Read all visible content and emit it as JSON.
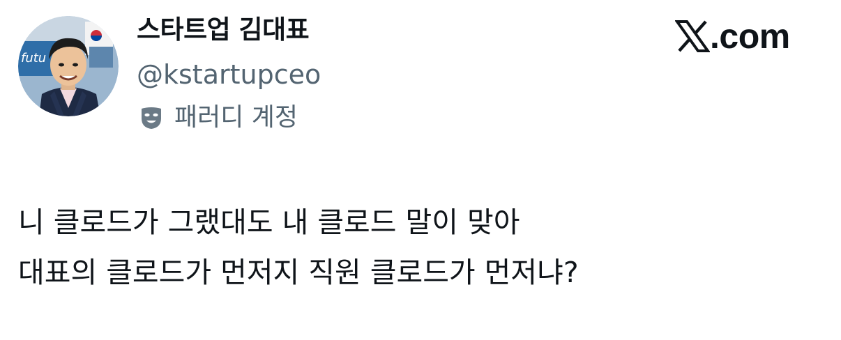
{
  "author": {
    "display_name": "스타트업 김대표",
    "handle": "@kstartupceo",
    "parody_label": "패러디 계정",
    "avatar_icon": "profile-avatar-illustration",
    "parody_icon": "theater-mask-icon"
  },
  "brand": {
    "label": ".com",
    "logo_icon": "x-logo-icon"
  },
  "tweet": {
    "lines": [
      "니 클로드가 그랬대도 내 클로드 말이 맞아",
      "대표의 클로드가 먼저지 직원 클로드가 먼저냐?"
    ]
  },
  "colors": {
    "text_primary": "#0f1419",
    "text_secondary": "#536471",
    "background": "#ffffff"
  }
}
